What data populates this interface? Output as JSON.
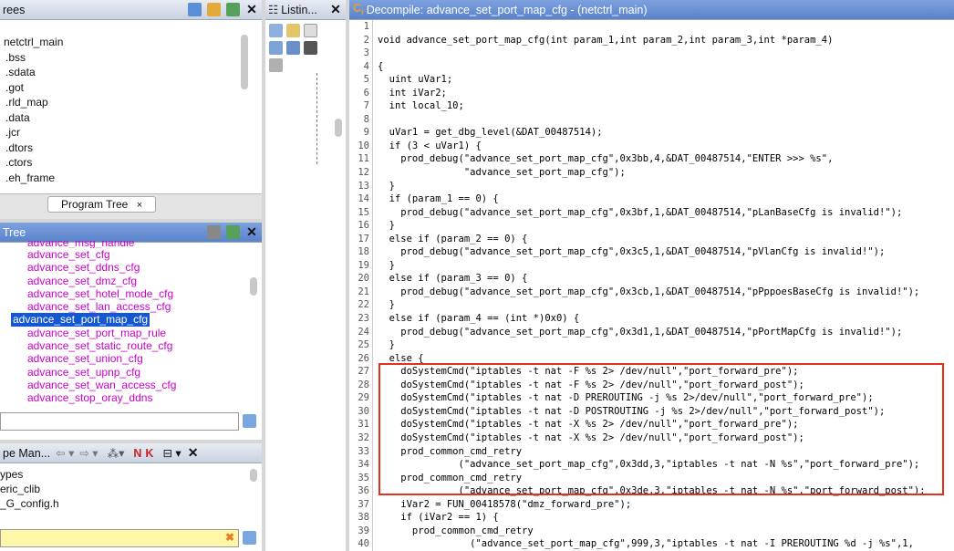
{
  "program_trees": {
    "title": "rees",
    "items": [
      "netctrl_main",
      ".bss",
      ".sdata",
      ".got",
      ".rld_map",
      ".data",
      ".jcr",
      ".dtors",
      ".ctors",
      ".eh_frame"
    ],
    "tab_label": "Program Tree",
    "tab_close": "×"
  },
  "symbol_tree": {
    "title": "Tree",
    "items": [
      "advance_msg_handle",
      "advance_set_cfg",
      "advance_set_ddns_cfg",
      "advance_set_dmz_cfg",
      "advance_set_hotel_mode_cfg",
      "advance_set_lan_access_cfg",
      "advance_set_port_map_cfg",
      "advance_set_port_map_rule",
      "advance_set_static_route_cfg",
      "advance_set_union_cfg",
      "advance_set_upnp_cfg",
      "advance_set_wan_access_cfg",
      "advance_stop_oray_ddns"
    ],
    "selected": 6
  },
  "data_types": {
    "title": "pe Man...",
    "items": [
      "ypes",
      "eric_clib",
      "_G_config.h"
    ]
  },
  "listing": {
    "title": "Listin..."
  },
  "decompile": {
    "title": "Decompile: advance_set_port_map_cfg -  (netctrl_main)"
  },
  "code_lines": [
    "",
    "void advance_set_port_map_cfg(int param_1,int param_2,int param_3,int *param_4)",
    "",
    "{",
    "  uint uVar1;",
    "  int iVar2;",
    "  int local_10;",
    "",
    "  uVar1 = get_dbg_level(&DAT_00487514);",
    "  if (3 < uVar1) {",
    "    prod_debug(\"advance_set_port_map_cfg\",0x3bb,4,&DAT_00487514,\"ENTER >>> %s\",",
    "               \"advance_set_port_map_cfg\");",
    "  }",
    "  if (param_1 == 0) {",
    "    prod_debug(\"advance_set_port_map_cfg\",0x3bf,1,&DAT_00487514,\"pLanBaseCfg is invalid!\");",
    "  }",
    "  else if (param_2 == 0) {",
    "    prod_debug(\"advance_set_port_map_cfg\",0x3c5,1,&DAT_00487514,\"pVlanCfg is invalid!\");",
    "  }",
    "  else if (param_3 == 0) {",
    "    prod_debug(\"advance_set_port_map_cfg\",0x3cb,1,&DAT_00487514,\"pPppoesBaseCfg is invalid!\");",
    "  }",
    "  else if (param_4 == (int *)0x0) {",
    "    prod_debug(\"advance_set_port_map_cfg\",0x3d1,1,&DAT_00487514,\"pPortMapCfg is invalid!\");",
    "  }",
    "  else {",
    "    doSystemCmd(\"iptables -t nat -F %s 2> /dev/null\",\"port_forward_pre\");",
    "    doSystemCmd(\"iptables -t nat -F %s 2> /dev/null\",\"port_forward_post\");",
    "    doSystemCmd(\"iptables -t nat -D PREROUTING -j %s 2>/dev/null\",\"port_forward_pre\");",
    "    doSystemCmd(\"iptables -t nat -D POSTROUTING -j %s 2>/dev/null\",\"port_forward_post\");",
    "    doSystemCmd(\"iptables -t nat -X %s 2> /dev/null\",\"port_forward_pre\");",
    "    doSystemCmd(\"iptables -t nat -X %s 2> /dev/null\",\"port_forward_post\");",
    "    prod_common_cmd_retry",
    "              (\"advance_set_port_map_cfg\",0x3dd,3,\"iptables -t nat -N %s\",\"port_forward_pre\");",
    "    prod_common_cmd_retry",
    "              (\"advance_set_port_map_cfg\",0x3de,3,\"iptables -t nat -N %s\",\"port_forward_post\");",
    "    iVar2 = FUN_00418578(\"dmz_forward_pre\");",
    "    if (iVar2 == 1) {",
    "      prod_common_cmd_retry",
    "                (\"advance_set_port_map_cfg\",999,3,\"iptables -t nat -I PREROUTING %d -j %s\",1,"
  ],
  "highlight": {
    "color": "#e0301e"
  }
}
